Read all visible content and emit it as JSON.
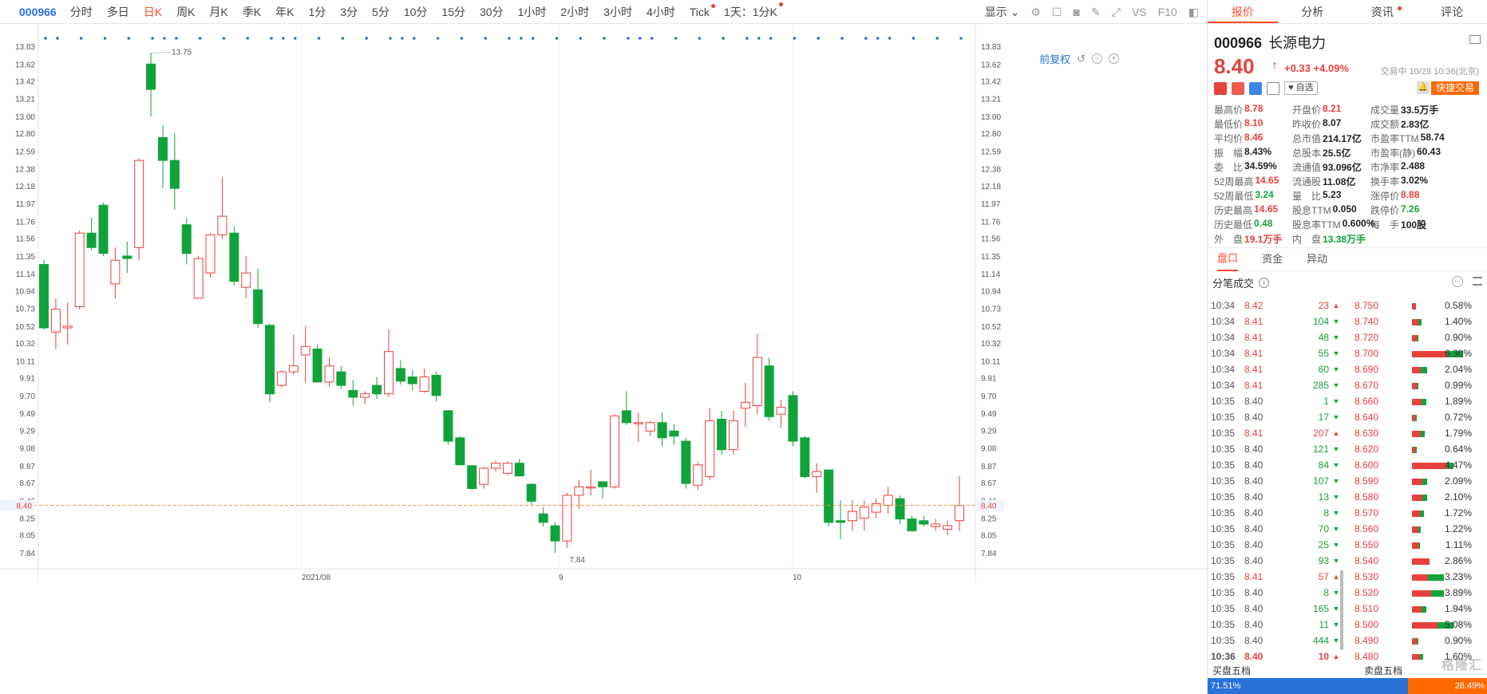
{
  "toolbar": {
    "code": "000966",
    "periods": [
      {
        "label": "分时"
      },
      {
        "label": "多日"
      },
      {
        "label": "日K",
        "active": true
      },
      {
        "label": "周K"
      },
      {
        "label": "月K"
      },
      {
        "label": "季K"
      },
      {
        "label": "年K"
      },
      {
        "label": "1分"
      },
      {
        "label": "3分"
      },
      {
        "label": "5分"
      },
      {
        "label": "10分"
      },
      {
        "label": "15分"
      },
      {
        "label": "30分"
      },
      {
        "label": "1小时"
      },
      {
        "label": "2小时"
      },
      {
        "label": "3小时"
      },
      {
        "label": "4小时"
      },
      {
        "label": "Tick",
        "dot": true
      },
      {
        "label": "1天：1分K",
        "dot": true
      }
    ],
    "display_label": "显示",
    "vs_label": "VS",
    "f10_label": "F10"
  },
  "chart_tools": {
    "adjust_label": "前复权"
  },
  "chart_data": {
    "type": "candlestick",
    "y_ticks": [
      "13.83",
      "13.62",
      "13.42",
      "13.21",
      "13.00",
      "12.80",
      "12.59",
      "12.38",
      "12.18",
      "11.97",
      "11.76",
      "11.56",
      "11.35",
      "11.14",
      "10.94",
      "10.73",
      "10.52",
      "10.32",
      "10.11",
      "9.91",
      "9.70",
      "9.49",
      "9.29",
      "9.08",
      "8.87",
      "8.67",
      "8.46",
      "8.25",
      "8.05",
      "7.84"
    ],
    "ylim": [
      7.84,
      13.83
    ],
    "x_labels": [
      "2021/08",
      "9",
      "10"
    ],
    "current_price": "8.40",
    "high_label": "13.75",
    "low_label": "7.84",
    "candles": [
      {
        "o": 11.25,
        "h": 11.3,
        "l": 10.48,
        "c": 10.5
      },
      {
        "o": 10.45,
        "h": 10.85,
        "l": 10.25,
        "c": 10.72
      },
      {
        "o": 10.5,
        "h": 10.8,
        "l": 10.3,
        "c": 10.52
      },
      {
        "o": 10.75,
        "h": 11.65,
        "l": 10.72,
        "c": 11.62
      },
      {
        "o": 11.62,
        "h": 11.8,
        "l": 11.42,
        "c": 11.45
      },
      {
        "o": 11.95,
        "h": 11.98,
        "l": 11.35,
        "c": 11.38
      },
      {
        "o": 11.02,
        "h": 11.45,
        "l": 10.85,
        "c": 11.3
      },
      {
        "o": 11.35,
        "h": 11.52,
        "l": 11.15,
        "c": 11.32
      },
      {
        "o": 11.45,
        "h": 12.5,
        "l": 11.3,
        "c": 12.48
      },
      {
        "o": 13.62,
        "h": 13.75,
        "l": 13.0,
        "c": 13.32
      },
      {
        "o": 12.75,
        "h": 12.9,
        "l": 12.15,
        "c": 12.48
      },
      {
        "o": 12.48,
        "h": 12.8,
        "l": 11.9,
        "c": 12.15
      },
      {
        "o": 11.72,
        "h": 11.8,
        "l": 11.25,
        "c": 11.38
      },
      {
        "o": 10.85,
        "h": 11.35,
        "l": 10.85,
        "c": 11.32
      },
      {
        "o": 11.15,
        "h": 11.62,
        "l": 11.1,
        "c": 11.6
      },
      {
        "o": 11.6,
        "h": 12.28,
        "l": 11.55,
        "c": 11.82
      },
      {
        "o": 11.62,
        "h": 11.7,
        "l": 11.0,
        "c": 11.05
      },
      {
        "o": 10.98,
        "h": 11.35,
        "l": 10.85,
        "c": 11.15
      },
      {
        "o": 10.95,
        "h": 11.2,
        "l": 10.5,
        "c": 10.55
      },
      {
        "o": 10.53,
        "h": 10.55,
        "l": 9.62,
        "c": 9.72
      },
      {
        "o": 9.82,
        "h": 10.0,
        "l": 9.8,
        "c": 9.98
      },
      {
        "o": 9.98,
        "h": 10.42,
        "l": 9.95,
        "c": 10.05
      },
      {
        "o": 10.18,
        "h": 10.52,
        "l": 9.85,
        "c": 10.28
      },
      {
        "o": 10.25,
        "h": 10.3,
        "l": 9.85,
        "c": 9.86
      },
      {
        "o": 9.86,
        "h": 10.15,
        "l": 9.8,
        "c": 10.05
      },
      {
        "o": 9.98,
        "h": 10.05,
        "l": 9.78,
        "c": 9.82
      },
      {
        "o": 9.76,
        "h": 9.88,
        "l": 9.58,
        "c": 9.68
      },
      {
        "o": 9.68,
        "h": 9.75,
        "l": 9.6,
        "c": 9.72
      },
      {
        "o": 9.82,
        "h": 9.92,
        "l": 9.66,
        "c": 9.72
      },
      {
        "o": 9.72,
        "h": 10.48,
        "l": 9.68,
        "c": 10.22
      },
      {
        "o": 10.02,
        "h": 10.12,
        "l": 9.83,
        "c": 9.87
      },
      {
        "o": 9.92,
        "h": 10.0,
        "l": 9.76,
        "c": 9.84
      },
      {
        "o": 9.75,
        "h": 10.02,
        "l": 9.73,
        "c": 9.92
      },
      {
        "o": 9.94,
        "h": 9.98,
        "l": 9.63,
        "c": 9.7
      },
      {
        "o": 9.52,
        "h": 9.53,
        "l": 9.12,
        "c": 9.16
      },
      {
        "o": 9.2,
        "h": 9.22,
        "l": 8.88,
        "c": 8.88
      },
      {
        "o": 8.87,
        "h": 8.88,
        "l": 8.58,
        "c": 8.6
      },
      {
        "o": 8.65,
        "h": 8.86,
        "l": 8.6,
        "c": 8.84
      },
      {
        "o": 8.84,
        "h": 8.93,
        "l": 8.8,
        "c": 8.9
      },
      {
        "o": 8.78,
        "h": 8.92,
        "l": 8.76,
        "c": 8.9
      },
      {
        "o": 8.9,
        "h": 8.95,
        "l": 8.74,
        "c": 8.75
      },
      {
        "o": 8.65,
        "h": 8.66,
        "l": 8.4,
        "c": 8.45
      },
      {
        "o": 8.3,
        "h": 8.38,
        "l": 8.15,
        "c": 8.2
      },
      {
        "o": 8.16,
        "h": 8.2,
        "l": 7.84,
        "c": 7.98
      },
      {
        "o": 7.98,
        "h": 8.55,
        "l": 7.9,
        "c": 8.52
      },
      {
        "o": 8.52,
        "h": 8.7,
        "l": 8.36,
        "c": 8.62
      },
      {
        "o": 8.62,
        "h": 8.82,
        "l": 8.52,
        "c": 8.62
      },
      {
        "o": 8.68,
        "h": 8.68,
        "l": 8.48,
        "c": 8.62
      },
      {
        "o": 8.62,
        "h": 9.48,
        "l": 8.6,
        "c": 9.46
      },
      {
        "o": 9.52,
        "h": 9.75,
        "l": 9.35,
        "c": 9.38
      },
      {
        "o": 9.38,
        "h": 9.5,
        "l": 9.15,
        "c": 9.38
      },
      {
        "o": 9.28,
        "h": 9.4,
        "l": 9.22,
        "c": 9.38
      },
      {
        "o": 9.38,
        "h": 9.5,
        "l": 9.1,
        "c": 9.2
      },
      {
        "o": 9.28,
        "h": 9.36,
        "l": 9.12,
        "c": 9.22
      },
      {
        "o": 9.16,
        "h": 9.2,
        "l": 8.6,
        "c": 8.66
      },
      {
        "o": 8.64,
        "h": 8.92,
        "l": 8.58,
        "c": 8.88
      },
      {
        "o": 8.74,
        "h": 9.55,
        "l": 8.7,
        "c": 9.4
      },
      {
        "o": 9.42,
        "h": 9.52,
        "l": 9.0,
        "c": 9.06
      },
      {
        "o": 9.06,
        "h": 9.52,
        "l": 9.0,
        "c": 9.4
      },
      {
        "o": 9.55,
        "h": 9.85,
        "l": 9.33,
        "c": 9.62
      },
      {
        "o": 9.58,
        "h": 10.43,
        "l": 9.48,
        "c": 10.15
      },
      {
        "o": 10.05,
        "h": 10.15,
        "l": 9.4,
        "c": 9.45
      },
      {
        "o": 9.48,
        "h": 9.65,
        "l": 9.32,
        "c": 9.56
      },
      {
        "o": 9.7,
        "h": 9.75,
        "l": 9.1,
        "c": 9.16
      },
      {
        "o": 9.2,
        "h": 9.22,
        "l": 8.72,
        "c": 8.74
      },
      {
        "o": 8.74,
        "h": 8.9,
        "l": 8.55,
        "c": 8.8
      },
      {
        "o": 8.82,
        "h": 8.82,
        "l": 8.15,
        "c": 8.2
      },
      {
        "o": 8.22,
        "h": 8.46,
        "l": 8.0,
        "c": 8.2
      },
      {
        "o": 8.22,
        "h": 8.46,
        "l": 8.1,
        "c": 8.33
      },
      {
        "o": 8.25,
        "h": 8.46,
        "l": 8.1,
        "c": 8.38
      },
      {
        "o": 8.32,
        "h": 8.48,
        "l": 8.25,
        "c": 8.42
      },
      {
        "o": 8.4,
        "h": 8.62,
        "l": 8.3,
        "c": 8.52
      },
      {
        "o": 8.48,
        "h": 8.52,
        "l": 8.18,
        "c": 8.24
      },
      {
        "o": 8.24,
        "h": 8.28,
        "l": 8.1,
        "c": 8.1
      },
      {
        "o": 8.22,
        "h": 8.28,
        "l": 8.15,
        "c": 8.18
      },
      {
        "o": 8.15,
        "h": 8.24,
        "l": 8.1,
        "c": 8.18
      },
      {
        "o": 8.12,
        "h": 8.22,
        "l": 8.05,
        "c": 8.16
      },
      {
        "o": 8.22,
        "h": 8.75,
        "l": 8.1,
        "c": 8.4
      }
    ]
  },
  "panel": {
    "tabs": [
      {
        "label": "报价",
        "active": true
      },
      {
        "label": "分析"
      },
      {
        "label": "资讯",
        "dot": true
      },
      {
        "label": "评论"
      }
    ],
    "stock": {
      "code": "000966",
      "name": "长源电力",
      "price": "8.40",
      "arrow": "↑",
      "change": "+0.33 +4.09%",
      "time": "交易中 10/28 10:36(北京)",
      "watch_label": "自选",
      "quick_trade": "快捷交易"
    },
    "quote_rows": [
      [
        {
          "lab": "最高价",
          "val": "8.78",
          "cls": "red"
        },
        {
          "lab": "开盘价",
          "val": "8.21",
          "cls": "red"
        },
        {
          "lab": "成交量",
          "val": "33.5万手",
          "cls": ""
        }
      ],
      [
        {
          "lab": "最低价",
          "val": "8.10",
          "cls": "red"
        },
        {
          "lab": "昨收价",
          "val": "8.07",
          "cls": ""
        },
        {
          "lab": "成交额",
          "val": "2.83亿",
          "cls": ""
        }
      ],
      [
        {
          "lab": "平均价",
          "val": "8.46",
          "cls": "red"
        },
        {
          "lab": "总市值",
          "val": "214.17亿",
          "cls": ""
        },
        {
          "lab": "市盈率TTM",
          "val": "58.74",
          "cls": ""
        }
      ],
      [
        {
          "lab": "振　幅",
          "val": "8.43%",
          "cls": ""
        },
        {
          "lab": "总股本",
          "val": "25.5亿",
          "cls": ""
        },
        {
          "lab": "市盈率(静)",
          "val": "60.43",
          "cls": ""
        }
      ],
      [
        {
          "lab": "委　比",
          "val": "34.59%",
          "cls": ""
        },
        {
          "lab": "流通值",
          "val": "93.096亿",
          "cls": ""
        },
        {
          "lab": "市净率",
          "val": "2.488",
          "cls": ""
        }
      ],
      [
        {
          "lab": "52周最高",
          "val": "14.65",
          "cls": "red"
        },
        {
          "lab": "流通股",
          "val": "11.08亿",
          "cls": ""
        },
        {
          "lab": "换手率",
          "val": "3.02%",
          "cls": ""
        }
      ],
      [
        {
          "lab": "52周最低",
          "val": "3.24",
          "cls": "green"
        },
        {
          "lab": "量　比",
          "val": "5.23",
          "cls": ""
        },
        {
          "lab": "涨停价",
          "val": "8.88",
          "cls": "red"
        }
      ],
      [
        {
          "lab": "历史最高",
          "val": "14.65",
          "cls": "red"
        },
        {
          "lab": "股息TTM",
          "val": "0.050",
          "cls": ""
        },
        {
          "lab": "跌停价",
          "val": "7.26",
          "cls": "green"
        }
      ],
      [
        {
          "lab": "历史最低",
          "val": "0.48",
          "cls": "green"
        },
        {
          "lab": "股息率TTM",
          "val": "0.600%",
          "cls": ""
        },
        {
          "lab": "每　手",
          "val": "100股",
          "cls": ""
        }
      ],
      [
        {
          "lab": "外　盘",
          "val": "19.1万手",
          "cls": "red"
        },
        {
          "lab": "内　盘",
          "val": "13.38万手",
          "cls": "green"
        },
        {
          "lab": "",
          "val": "",
          "cls": ""
        }
      ]
    ],
    "subtabs": [
      {
        "label": "盘口",
        "active": true
      },
      {
        "label": "资金"
      },
      {
        "label": "异动"
      }
    ],
    "ticks_title": "分笔成交",
    "trades": [
      {
        "t": "10:34",
        "p": "8.42",
        "v": "23",
        "d": "up"
      },
      {
        "t": "10:34",
        "p": "8.41",
        "v": "104",
        "d": "down"
      },
      {
        "t": "10:34",
        "p": "8.41",
        "v": "48",
        "d": "down"
      },
      {
        "t": "10:34",
        "p": "8.41",
        "v": "55",
        "d": "down"
      },
      {
        "t": "10:34",
        "p": "8.41",
        "v": "60",
        "d": "down"
      },
      {
        "t": "10:34",
        "p": "8.41",
        "v": "285",
        "d": "down"
      },
      {
        "t": "10:35",
        "p": "8.40",
        "v": "1",
        "d": "down"
      },
      {
        "t": "10:35",
        "p": "8.40",
        "v": "17",
        "d": "down"
      },
      {
        "t": "10:35",
        "p": "8.41",
        "v": "207",
        "d": "up"
      },
      {
        "t": "10:35",
        "p": "8.40",
        "v": "121",
        "d": "down"
      },
      {
        "t": "10:35",
        "p": "8.40",
        "v": "84",
        "d": "down"
      },
      {
        "t": "10:35",
        "p": "8.40",
        "v": "107",
        "d": "down"
      },
      {
        "t": "10:35",
        "p": "8.40",
        "v": "13",
        "d": "down"
      },
      {
        "t": "10:35",
        "p": "8.40",
        "v": "8",
        "d": "down"
      },
      {
        "t": "10:35",
        "p": "8.40",
        "v": "70",
        "d": "down"
      },
      {
        "t": "10:35",
        "p": "8.40",
        "v": "25",
        "d": "down"
      },
      {
        "t": "10:35",
        "p": "8.40",
        "v": "93",
        "d": "down"
      },
      {
        "t": "10:35",
        "p": "8.41",
        "v": "57",
        "d": "up"
      },
      {
        "t": "10:35",
        "p": "8.40",
        "v": "8",
        "d": "down"
      },
      {
        "t": "10:35",
        "p": "8.40",
        "v": "165",
        "d": "down"
      },
      {
        "t": "10:35",
        "p": "8.40",
        "v": "11",
        "d": "down"
      },
      {
        "t": "10:35",
        "p": "8.40",
        "v": "444",
        "d": "down"
      },
      {
        "t": "10:36",
        "p": "8.40",
        "v": "10",
        "d": "up",
        "last": true
      }
    ],
    "levels": [
      {
        "p": "8.750",
        "pct": "0.58%",
        "r": 0.06,
        "g": 0.0
      },
      {
        "p": "8.740",
        "pct": "1.40%",
        "r": 0.1,
        "g": 0.05
      },
      {
        "p": "8.720",
        "pct": "0.90%",
        "r": 0.08,
        "g": 0.03
      },
      {
        "p": "8.700",
        "pct": "6.30%",
        "r": 0.55,
        "g": 0.25
      },
      {
        "p": "8.690",
        "pct": "2.04%",
        "r": 0.14,
        "g": 0.1
      },
      {
        "p": "8.670",
        "pct": "0.99%",
        "r": 0.07,
        "g": 0.03
      },
      {
        "p": "8.660",
        "pct": "1.89%",
        "r": 0.15,
        "g": 0.07
      },
      {
        "p": "8.640",
        "pct": "0.72%",
        "r": 0.05,
        "g": 0.02
      },
      {
        "p": "8.630",
        "pct": "1.79%",
        "r": 0.14,
        "g": 0.06
      },
      {
        "p": "8.620",
        "pct": "0.64%",
        "r": 0.05,
        "g": 0.02
      },
      {
        "p": "8.600",
        "pct": "4.47%",
        "r": 0.55,
        "g": 0.1
      },
      {
        "p": "8.590",
        "pct": "2.09%",
        "r": 0.16,
        "g": 0.08
      },
      {
        "p": "8.580",
        "pct": "2.10%",
        "r": 0.16,
        "g": 0.08
      },
      {
        "p": "8.570",
        "pct": "1.72%",
        "r": 0.13,
        "g": 0.06
      },
      {
        "p": "8.560",
        "pct": "1.22%",
        "r": 0.1,
        "g": 0.04
      },
      {
        "p": "8.550",
        "pct": "1.11%",
        "r": 0.1,
        "g": 0.03
      },
      {
        "p": "8.540",
        "pct": "2.86%",
        "r": 0.28,
        "g": 0.0
      },
      {
        "p": "8.530",
        "pct": "3.23%",
        "r": 0.25,
        "g": 0.25
      },
      {
        "p": "8.520",
        "pct": "3.89%",
        "r": 0.3,
        "g": 0.2
      },
      {
        "p": "8.510",
        "pct": "1.94%",
        "r": 0.15,
        "g": 0.08
      },
      {
        "p": "8.500",
        "pct": "5.08%",
        "r": 0.4,
        "g": 0.25
      },
      {
        "p": "8.490",
        "pct": "0.90%",
        "r": 0.08,
        "g": 0.02
      },
      {
        "p": "8.480",
        "pct": "1.60%",
        "r": 0.12,
        "g": 0.05
      }
    ],
    "five": {
      "buy_label": "买盘五档",
      "sell_label": "卖盘五档",
      "buy_pct": "71.51%",
      "sell_pct": "28.49%",
      "buy_ratio": 0.7151
    },
    "watermark": "格隆汇"
  }
}
